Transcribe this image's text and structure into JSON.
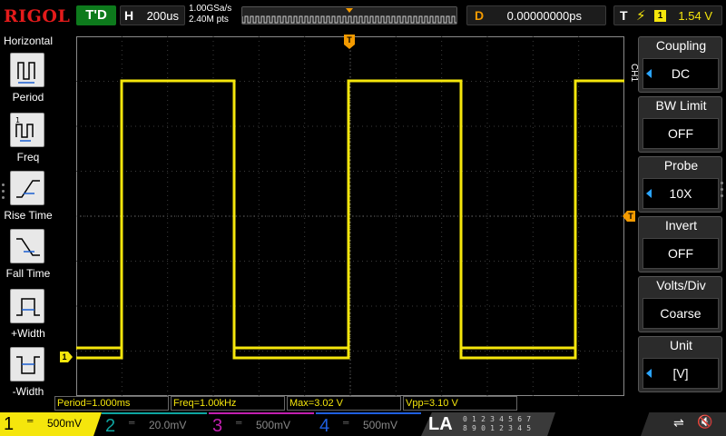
{
  "top": {
    "logo": "RIGOL",
    "run_state": "T'D",
    "horizontal": {
      "tag": "H",
      "value": "200us"
    },
    "sample_rate": "1.00GSa/s",
    "memory_depth": "2.40M pts",
    "delay": {
      "tag": "D",
      "value": "0.00000000ps"
    },
    "trigger": {
      "tag": "T",
      "source": "1",
      "level": "1.54 V"
    }
  },
  "left_menu": {
    "title": "Horizontal",
    "items": [
      {
        "label": "Period",
        "icon": "period-icon"
      },
      {
        "label": "Freq",
        "icon": "freq-icon"
      },
      {
        "label": "Rise Time",
        "icon": "rise-time-icon"
      },
      {
        "label": "Fall Time",
        "icon": "fall-time-icon"
      },
      {
        "label": "+Width",
        "icon": "pos-width-icon"
      },
      {
        "label": "-Width",
        "icon": "neg-width-icon"
      }
    ]
  },
  "right_menu": {
    "channel_tab": "CH1",
    "items": [
      {
        "title": "Coupling",
        "value": "DC",
        "has_arrow": true
      },
      {
        "title": "BW Limit",
        "value": "OFF",
        "has_arrow": false
      },
      {
        "title": "Probe",
        "value": "10X",
        "has_arrow": true
      },
      {
        "title": "Invert",
        "value": "OFF",
        "has_arrow": false
      },
      {
        "title": "Volts/Div",
        "value": "Coarse",
        "has_arrow": false
      },
      {
        "title": "Unit",
        "value": "[V]",
        "has_arrow": true
      }
    ]
  },
  "measurements": [
    "Period=1.000ms",
    "Freq=1.00kHz",
    "Max=3.02 V",
    "Vpp=3.10 V"
  ],
  "channels": [
    {
      "num": "1",
      "coupling": "═",
      "scale": "500mV",
      "color": "#f5e60c"
    },
    {
      "num": "2",
      "coupling": "═",
      "scale": "20.0mV",
      "color": "#0ea5a0"
    },
    {
      "num": "3",
      "coupling": "═",
      "scale": "500mV",
      "color": "#c21fb0"
    },
    {
      "num": "4",
      "coupling": "═",
      "scale": "500mV",
      "color": "#1f5fe0"
    }
  ],
  "la": {
    "label": "LA",
    "row1": "0 1 2 3  4 5 6 7",
    "row2": "8 9 0 1  2 3 4 5"
  },
  "system": {
    "usb_icon": "usb-icon",
    "speaker_icon": "speaker-muted-icon"
  },
  "trigger_markers": {
    "position_label": "T",
    "level_label": "T",
    "channel1_marker": "1"
  },
  "colors": {
    "ch1_trace": "#f5e60c",
    "trigger_marker": "#f39a00",
    "menu_arrow": "#2aa4ff",
    "brand": "#e41b1b",
    "run_state_bg": "#0d7a1c"
  }
}
